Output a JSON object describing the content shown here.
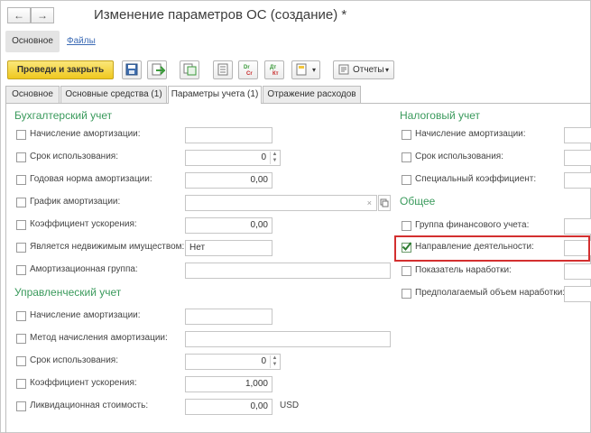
{
  "window": {
    "title": "Изменение параметров ОС (создание) *",
    "nav_back": "←",
    "nav_forward": "→"
  },
  "top_tabs": {
    "main": "Основное",
    "files": "Файлы"
  },
  "toolbar": {
    "post_close": "Проведи и закрыть",
    "reports": "Отчеты",
    "reports_arrow": "▾",
    "print_arrow": "▾",
    "dt_kt_label1": "Dr Cr",
    "dt_kt_label2": "Дт Кт"
  },
  "section_tabs": [
    {
      "label": "Основное"
    },
    {
      "label": "Основные средства (1)"
    },
    {
      "label": "Параметры учета (1)"
    },
    {
      "label": "Отражение расходов"
    }
  ],
  "accounting": {
    "title": "Бухгалтерский учет",
    "rows": [
      {
        "label": "Начисление амортизации:",
        "value": ""
      },
      {
        "label": "Срок использования:",
        "value": "0"
      },
      {
        "label": "Годовая норма амортизации:",
        "value": "0,00"
      },
      {
        "label": "График амортизации:",
        "value": ""
      },
      {
        "label": "Коэффициент ускорения:",
        "value": "0,00"
      },
      {
        "label": "Является недвижимым имуществом:",
        "value": "Нет"
      },
      {
        "label": "Амортизационная группа:",
        "value": ""
      }
    ]
  },
  "management": {
    "title": "Управленческий учет",
    "rows": [
      {
        "label": "Начисление амортизации:",
        "value": ""
      },
      {
        "label": "Метод начисления амортизации:",
        "value": ""
      },
      {
        "label": "Срок использования:",
        "value": "0"
      },
      {
        "label": "Коэффициент ускорения:",
        "value": "1,000"
      },
      {
        "label": "Ликвидационная стоимость:",
        "value": "0,00",
        "unit": "USD"
      }
    ]
  },
  "tax": {
    "title": "Налоговый учет",
    "rows": [
      {
        "label": "Начисление амортизации:"
      },
      {
        "label": "Срок использования:"
      },
      {
        "label": "Специальный коэффициент:"
      }
    ]
  },
  "general": {
    "title": "Общее",
    "rows": [
      {
        "label": "Группа финансового учета:",
        "checked": false
      },
      {
        "label": "Направление деятельности:",
        "checked": true
      },
      {
        "label": "Показатель наработки:",
        "checked": false
      },
      {
        "label": "Предполагаемый объем наработки:",
        "checked": false
      }
    ]
  },
  "colors": {
    "section_title": "#3a9a5c",
    "primary_button": "#efc81f",
    "highlight": "#d32f2f",
    "link": "#3c6bb5"
  }
}
